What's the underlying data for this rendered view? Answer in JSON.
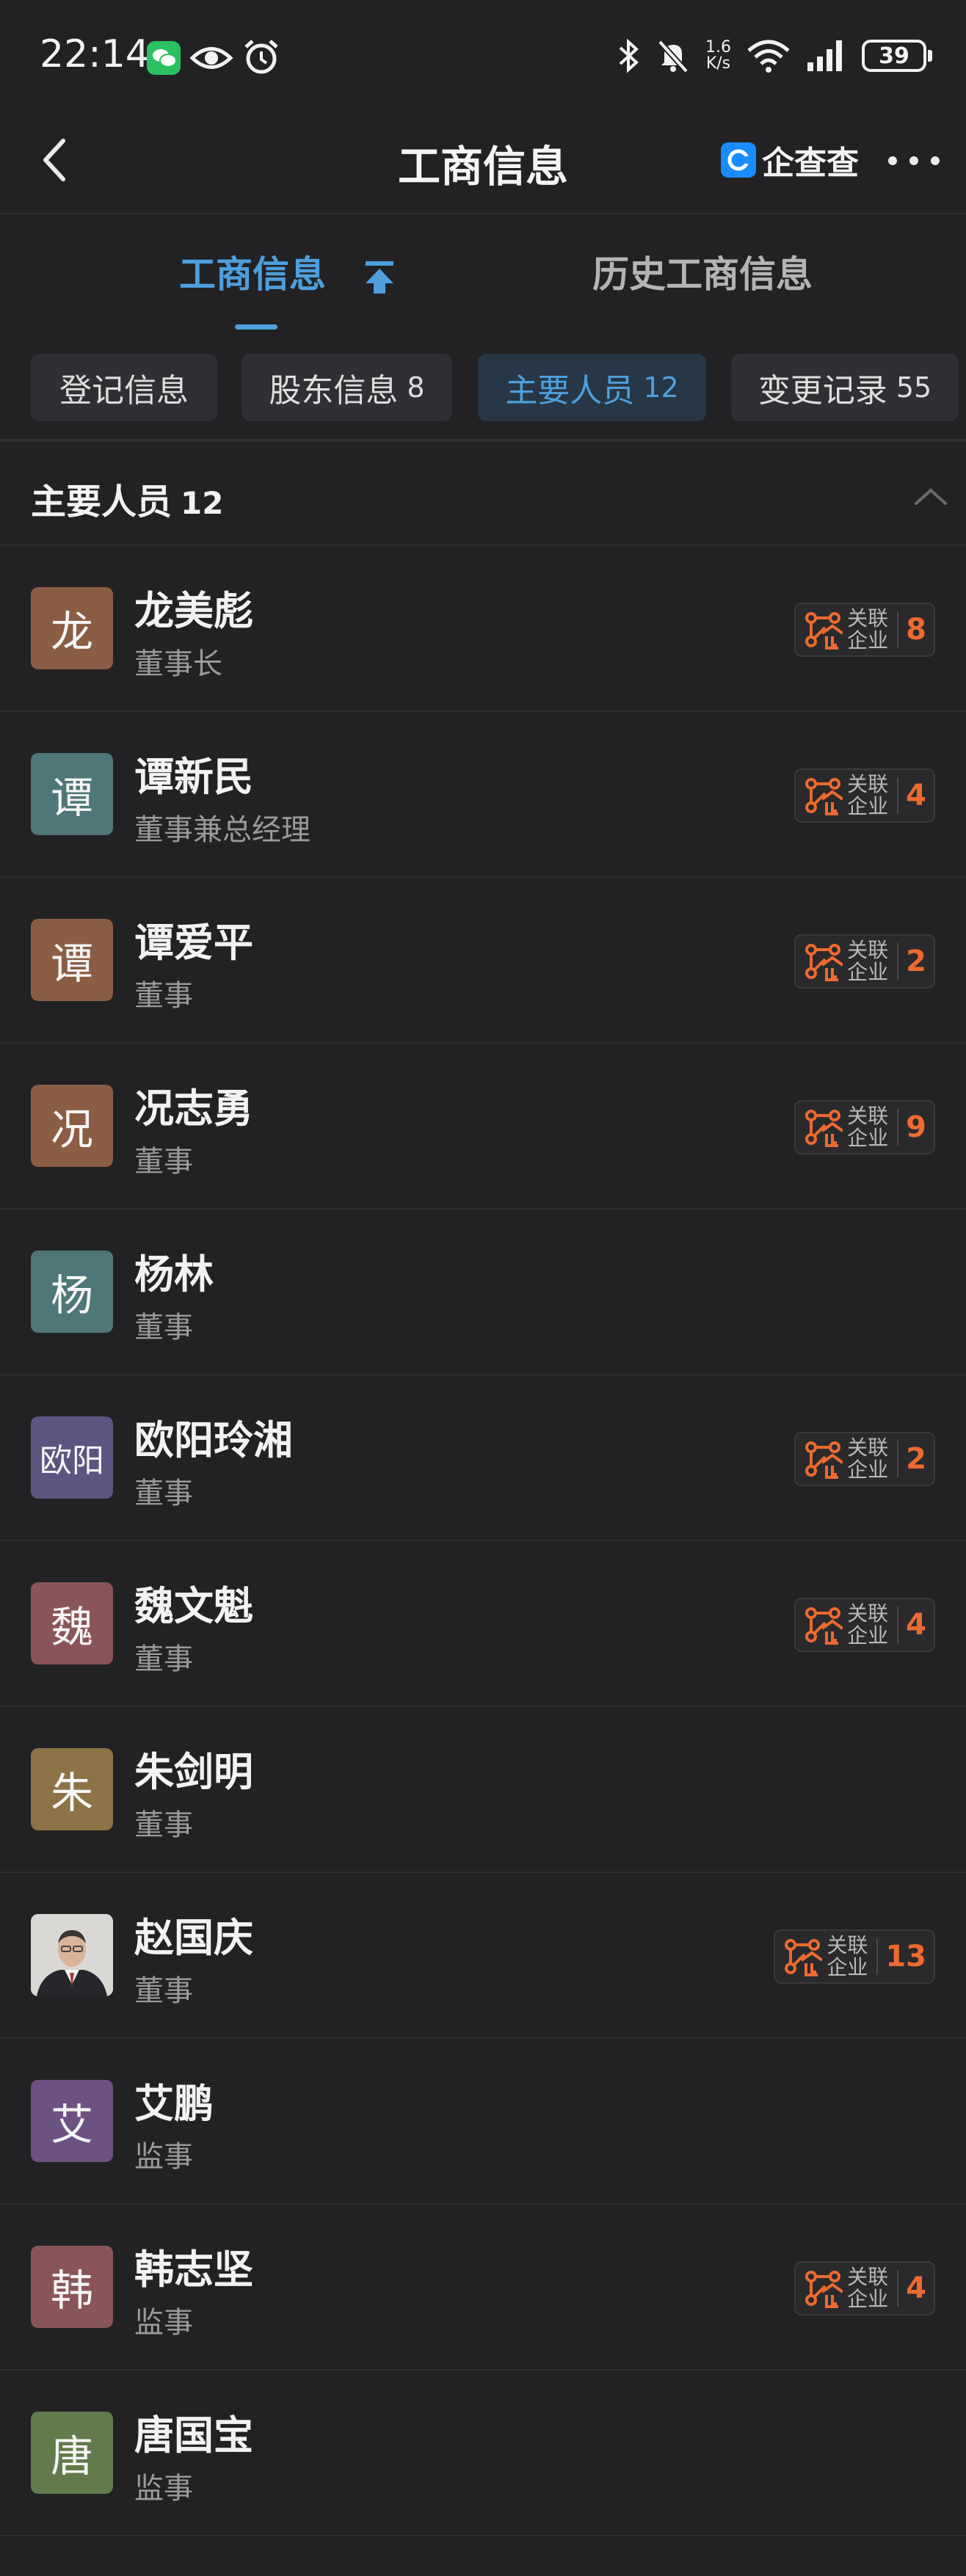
{
  "status_bar": {
    "time": "22:14",
    "speed_value": "1.6",
    "speed_unit": "K/s",
    "battery": "39"
  },
  "nav": {
    "title": "工商信息",
    "brand": "企查查"
  },
  "main_tabs": [
    {
      "label": "工商信息",
      "active": true
    },
    {
      "label": "历史工商信息",
      "active": false
    }
  ],
  "chips": [
    {
      "label": "登记信息",
      "count": ""
    },
    {
      "label": "股东信息",
      "count": "8"
    },
    {
      "label": "主要人员",
      "count": "12",
      "active": true
    },
    {
      "label": "变更记录",
      "count": "55"
    }
  ],
  "section": {
    "title": "主要人员",
    "count": "12"
  },
  "badge_label": "关联企业",
  "people": [
    {
      "avatar_char": "龙",
      "avatar_color": "#8c5d45",
      "name": "龙美彪",
      "role": "董事长",
      "related": "8"
    },
    {
      "avatar_char": "谭",
      "avatar_color": "#4f7679",
      "name": "谭新民",
      "role": "董事兼总经理",
      "related": "4"
    },
    {
      "avatar_char": "谭",
      "avatar_color": "#8c5d45",
      "name": "谭爱平",
      "role": "董事",
      "related": "2"
    },
    {
      "avatar_char": "况",
      "avatar_color": "#8c5d45",
      "name": "况志勇",
      "role": "董事",
      "related": "9"
    },
    {
      "avatar_char": "杨",
      "avatar_color": "#4f7679",
      "name": "杨林",
      "role": "董事",
      "related": ""
    },
    {
      "avatar_char": "欧阳",
      "avatar_color": "#5e5480",
      "name": "欧阳玲湘",
      "role": "董事",
      "related": "2"
    },
    {
      "avatar_char": "魏",
      "avatar_color": "#8a5559",
      "name": "魏文魁",
      "role": "董事",
      "related": "4"
    },
    {
      "avatar_char": "朱",
      "avatar_color": "#8c7447",
      "name": "朱剑明",
      "role": "董事",
      "related": ""
    },
    {
      "avatar_char": "",
      "avatar_color": "#d8d6d2",
      "name": "赵国庆",
      "role": "董事",
      "related": "13",
      "photo": true
    },
    {
      "avatar_char": "艾",
      "avatar_color": "#6c5280",
      "name": "艾鹏",
      "role": "监事",
      "related": ""
    },
    {
      "avatar_char": "韩",
      "avatar_color": "#8a5559",
      "name": "韩志坚",
      "role": "监事",
      "related": "4"
    },
    {
      "avatar_char": "唐",
      "avatar_color": "#627b4c",
      "name": "唐国宝",
      "role": "监事",
      "related": ""
    }
  ]
}
